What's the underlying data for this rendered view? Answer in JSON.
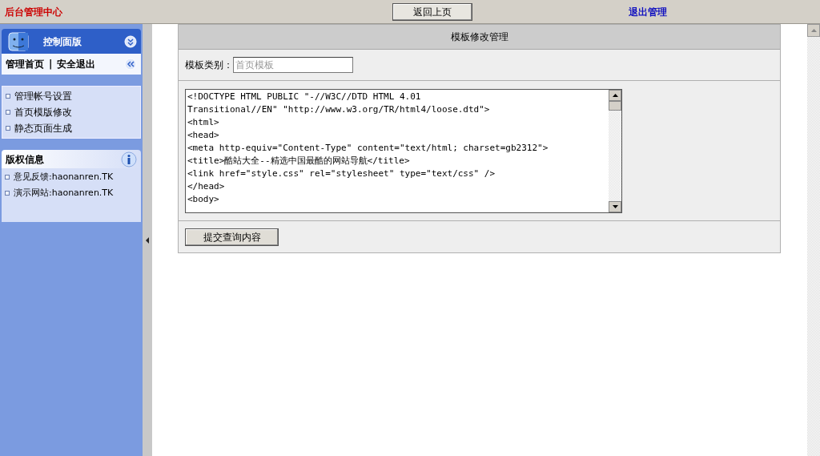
{
  "top_bar": {
    "title": "后台管理中心",
    "back_button": "返回上页",
    "logout_link": "退出管理"
  },
  "sidebar": {
    "panel_title": "控制面版",
    "quick_links": [
      "管理首页",
      "|",
      "安全退出"
    ],
    "menu": [
      "管理帐号设置",
      "首页模版修改",
      "静态页面生成"
    ],
    "info_title": "版权信息",
    "info_items": [
      "意见反馈:haonanren.TK",
      "演示网站:haonanren.TK"
    ]
  },
  "main": {
    "title": "模板修改管理",
    "category_label": "模板类别：",
    "category_placeholder": "首页模板",
    "code_lines": [
      "<!DOCTYPE HTML PUBLIC \"-//W3C//DTD HTML 4.01",
      "Transitional//EN\" \"http://www.w3.org/TR/html4/loose.dtd\">",
      "<html>",
      "<head>",
      "<meta http-equiv=\"Content-Type\" content=\"text/html; charset=gb2312\">",
      "<title>酷站大全--精选中国最酷的网站导航</title>",
      "<link href=\"style.css\" rel=\"stylesheet\" type=\"text/css\" />",
      "</head>",
      "<body>"
    ],
    "submit_button": "提交查询内容"
  }
}
